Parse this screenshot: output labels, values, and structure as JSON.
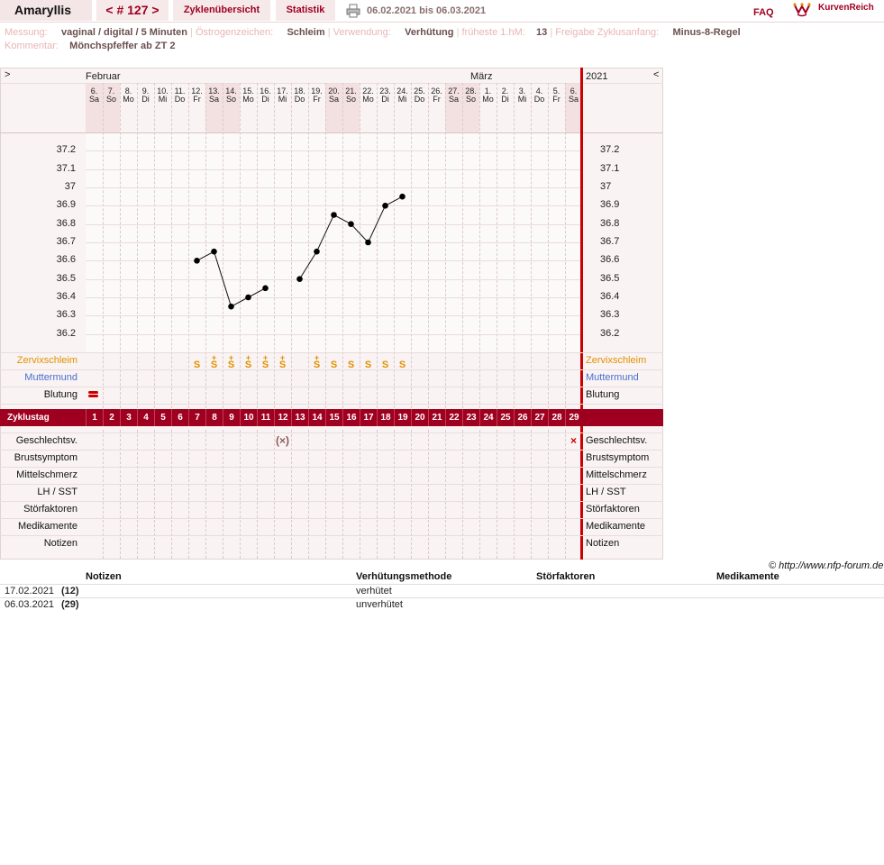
{
  "header": {
    "user": "Amaryllis",
    "cycle": "< # 127 >",
    "overview": "Zyklenübersicht",
    "stats": "Statistik",
    "date_range": "06.02.2021 bis 06.03.2021",
    "faq": "FAQ",
    "logo": "KurvenReich"
  },
  "info": {
    "messung_label": "Messung:",
    "messung": "vaginal / digital / 5 Minuten",
    "oestrogen_label": "Östrogenzeichen:",
    "oestrogen": "Schleim",
    "verwendung_label": "Verwendung:",
    "verwendung": "Verhütung",
    "hm_label": "früheste 1.hM:",
    "hm": "13",
    "freigabe_label": "Freigabe Zyklusanfang:",
    "freigabe": "Minus-8-Regel",
    "kommentar_label": "Kommentar:",
    "kommentar": "Mönchspfeffer ab ZT 2"
  },
  "chart": {
    "nav_left": ">",
    "nav_right": "<",
    "year": "2021",
    "month1": "Februar",
    "month2": "März",
    "dates": [
      "6.",
      "7.",
      "8.",
      "9.",
      "10.",
      "11.",
      "12.",
      "13.",
      "14.",
      "15.",
      "16.",
      "17.",
      "18.",
      "19.",
      "20.",
      "21.",
      "22.",
      "23.",
      "24.",
      "25.",
      "26.",
      "27.",
      "28.",
      "1.",
      "2.",
      "3.",
      "4.",
      "5.",
      "6."
    ],
    "weekdays": [
      "Sa",
      "So",
      "Mo",
      "Di",
      "Mi",
      "Do",
      "Fr",
      "Sa",
      "So",
      "Mo",
      "Di",
      "Mi",
      "Do",
      "Fr",
      "Sa",
      "So",
      "Mo",
      "Di",
      "Mi",
      "Do",
      "Fr",
      "Sa",
      "So",
      "Mo",
      "Di",
      "Mi",
      "Do",
      "Fr",
      "Sa"
    ],
    "weekend_days": [
      1,
      2,
      8,
      9,
      15,
      16,
      22,
      23,
      29
    ],
    "temp_ticks": [
      "37.2",
      "37.1",
      "37",
      "36.9",
      "36.8",
      "36.7",
      "36.6",
      "36.5",
      "36.4",
      "36.3",
      "36.2"
    ],
    "rows_top": [
      "Zervixschleim",
      "Muttermund",
      "Blutung"
    ],
    "row_colors": {
      "Zervixschleim": "#e39000",
      "Muttermund": "#4a6fcf",
      "Blutung": "#111111"
    },
    "zyklustag_label": "Zyklustag",
    "cycle_days": [
      "1",
      "2",
      "3",
      "4",
      "5",
      "6",
      "7",
      "8",
      "9",
      "10",
      "11",
      "12",
      "13",
      "14",
      "15",
      "16",
      "17",
      "18",
      "19",
      "20",
      "21",
      "22",
      "23",
      "24",
      "25",
      "26",
      "27",
      "28",
      "29"
    ],
    "rows_bottom": [
      "Geschlechtsv.",
      "Brustsymptom",
      "Mittelschmerz",
      "LH / SST",
      "Störfaktoren",
      "Medikamente",
      "Notizen"
    ],
    "mucus": [
      {
        "day": 7,
        "sym": "S"
      },
      {
        "day": 8,
        "sym": "Ṡ̶"
      },
      {
        "day": 9,
        "sym": "Ṡ̶"
      },
      {
        "day": 10,
        "sym": "Ṡ̶"
      },
      {
        "day": 11,
        "sym": "Ṡ̶"
      },
      {
        "day": 12,
        "sym": "Ṡ̶"
      },
      {
        "day": 14,
        "sym": "Ṡ̶"
      },
      {
        "day": 15,
        "sym": "S"
      },
      {
        "day": 16,
        "sym": "S"
      },
      {
        "day": 17,
        "sym": "S"
      },
      {
        "day": 18,
        "sym": "S"
      },
      {
        "day": 19,
        "sym": "S"
      }
    ],
    "mucus_marks": {
      "plus": [
        8,
        9,
        10,
        11,
        12,
        14
      ]
    },
    "bleeding_day": 1,
    "intercourse": [
      {
        "day": 12,
        "sym": "(×)",
        "color": "#8a5a5a"
      },
      {
        "day": 29,
        "sym": "×",
        "color": "#cc0000"
      }
    ],
    "copyright": "© http://www.nfp-forum.de"
  },
  "chart_data": {
    "type": "line",
    "x": [
      7,
      8,
      9,
      10,
      11,
      13,
      14,
      15,
      16,
      17,
      18,
      19
    ],
    "values": [
      36.6,
      36.65,
      36.35,
      36.4,
      36.45,
      36.5,
      36.65,
      36.85,
      36.8,
      36.7,
      36.9,
      36.95
    ],
    "xlabel": "Zyklustag",
    "ylim": [
      36.1,
      37.3
    ],
    "grid": true
  },
  "notes": {
    "headers": {
      "notizen": "Notizen",
      "methode": "Verhütungsmethode",
      "stoer": "Störfaktoren",
      "medi": "Medikamente"
    },
    "rows": [
      {
        "date": "17.02.2021",
        "day": "(12)",
        "methode": "verhütet"
      },
      {
        "date": "06.03.2021",
        "day": "(29)",
        "methode": "unverhütet"
      }
    ]
  }
}
